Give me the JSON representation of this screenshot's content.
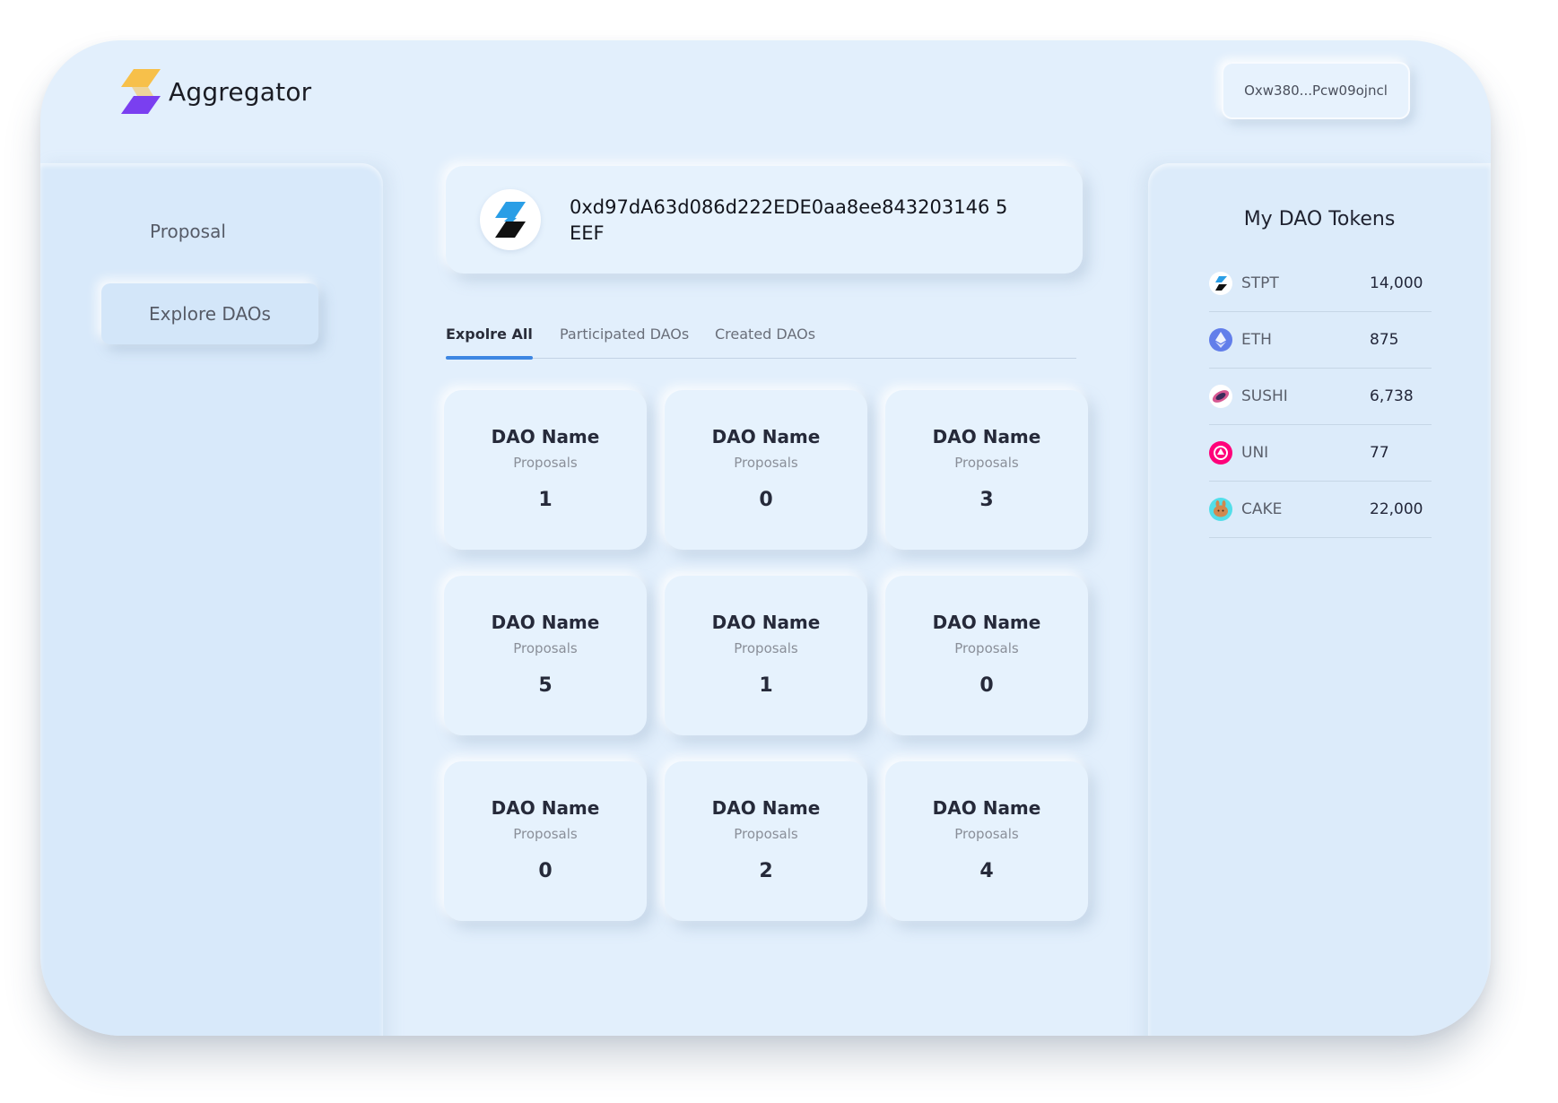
{
  "app": {
    "name": "Aggregator"
  },
  "header": {
    "wallet": "Oxw380...Pcw09ojncl"
  },
  "sidebar": {
    "items": [
      {
        "label": "Proposal",
        "active": false
      },
      {
        "label": "Explore DAOs",
        "active": true
      }
    ]
  },
  "profile": {
    "address": "0xd97dA63d086d222EDE0aa8ee843203146 5EEF"
  },
  "tabs": [
    {
      "label": "Expolre All",
      "active": true
    },
    {
      "label": "Participated DAOs",
      "active": false
    },
    {
      "label": "Created DAOs",
      "active": false
    }
  ],
  "daos": [
    {
      "name": "DAO Name",
      "subtitle": "Proposals",
      "count": "1"
    },
    {
      "name": "DAO Name",
      "subtitle": "Proposals",
      "count": "0"
    },
    {
      "name": "DAO Name",
      "subtitle": "Proposals",
      "count": "3"
    },
    {
      "name": "DAO Name",
      "subtitle": "Proposals",
      "count": "5"
    },
    {
      "name": "DAO Name",
      "subtitle": "Proposals",
      "count": "1"
    },
    {
      "name": "DAO Name",
      "subtitle": "Proposals",
      "count": "0"
    },
    {
      "name": "DAO Name",
      "subtitle": "Proposals",
      "count": "0"
    },
    {
      "name": "DAO Name",
      "subtitle": "Proposals",
      "count": "2"
    },
    {
      "name": "DAO Name",
      "subtitle": "Proposals",
      "count": "4"
    }
  ],
  "tokens_panel": {
    "title": "My DAO Tokens",
    "tokens": [
      {
        "symbol": "STPT",
        "value": "14,000",
        "icon": "stpt-icon",
        "color": "#1a1a1a"
      },
      {
        "symbol": "ETH",
        "value": "875",
        "icon": "eth-icon",
        "color": "#627eea"
      },
      {
        "symbol": "SUSHI",
        "value": "6,738",
        "icon": "sushi-icon",
        "color": "#d65892"
      },
      {
        "symbol": "UNI",
        "value": "77",
        "icon": "uni-icon",
        "color": "#ff007a"
      },
      {
        "symbol": "CAKE",
        "value": "22,000",
        "icon": "cake-icon",
        "color": "#d1884f"
      }
    ]
  },
  "colors": {
    "background": "#e2effc",
    "accent": "#3d86e2",
    "logo_top": "#f7c04a",
    "logo_bottom": "#7a3ff0"
  }
}
